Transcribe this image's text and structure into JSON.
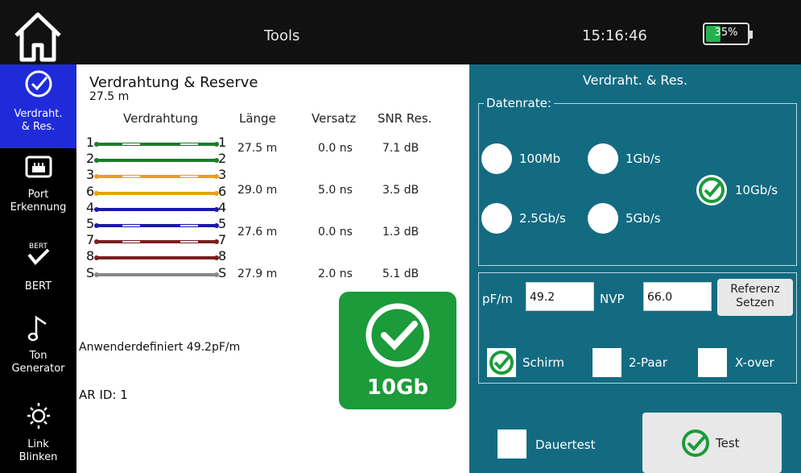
{
  "topbar": {
    "title": "Tools",
    "time": "15:16:46",
    "battery": "35%",
    "battery_level": 0.35
  },
  "sidebar": {
    "items": [
      {
        "label": "Verdraht.\n& Res.",
        "icon": "check-circle-icon"
      },
      {
        "label": "Port\nErkennung",
        "icon": "ethernet-port-icon"
      },
      {
        "label": "BERT",
        "icon": "bert-check-icon"
      },
      {
        "label": "Ton\nGenerator",
        "icon": "music-note-icon"
      },
      {
        "label": "Link\nBlinken",
        "icon": "sun-icon"
      }
    ]
  },
  "wiremap": {
    "title": "Verdrahtung & Reserve",
    "length": "27.5 m",
    "headers": {
      "wiring": "Verdrahtung",
      "length": "Länge",
      "skew": "Versatz",
      "snr": "SNR Res."
    },
    "wires": [
      {
        "left": "1",
        "right": "1",
        "color": "#1c7c2a",
        "stripe": true
      },
      {
        "left": "2",
        "right": "2",
        "color": "#1c7c2a",
        "stripe": false
      },
      {
        "left": "3",
        "right": "3",
        "color": "#e8a018",
        "stripe": true
      },
      {
        "left": "6",
        "right": "6",
        "color": "#e8a018",
        "stripe": false
      },
      {
        "left": "4",
        "right": "4",
        "color": "#1a1aa8",
        "stripe": false
      },
      {
        "left": "5",
        "right": "5",
        "color": "#1a1aa8",
        "stripe": true
      },
      {
        "left": "7",
        "right": "7",
        "color": "#7a1e1e",
        "stripe": true
      },
      {
        "left": "8",
        "right": "8",
        "color": "#7a1e1e",
        "stripe": false
      },
      {
        "left": "S",
        "right": "S",
        "color": "#888888",
        "stripe": false
      }
    ],
    "pairs": [
      {
        "length": "27.5 m",
        "skew": "0.0 ns",
        "snr": "7.1 dB"
      },
      {
        "length": "29.0 m",
        "skew": "5.0 ns",
        "snr": "3.5 dB"
      },
      {
        "length": "27.6 m",
        "skew": "0.0 ns",
        "snr": "1.3 dB"
      },
      {
        "length": "27.9 m",
        "skew": "2.0 ns",
        "snr": "5.1 dB"
      }
    ],
    "custom": "Anwenderdefiniert  49.2pF/m",
    "ar_id": "AR ID: 1",
    "result": "10Gb"
  },
  "settings": {
    "title": "Verdraht. & Res.",
    "datarate_label": "Datenrate:",
    "rates": [
      "100Mb",
      "1Gb/s",
      "10Gb/s",
      "2.5Gb/s",
      "5Gb/s"
    ],
    "selected_rate": "10Gb/s",
    "pf_label": "pF/m",
    "pf_value": "49.2",
    "nvp_label": "NVP",
    "nvp_value": "66.0",
    "ref_button": "Referenz\nSetzen",
    "shield_label": "Schirm",
    "twopair_label": "2-Paar",
    "xover_label": "X-over",
    "continuous_label": "Dauertest",
    "test_button": "Test"
  }
}
